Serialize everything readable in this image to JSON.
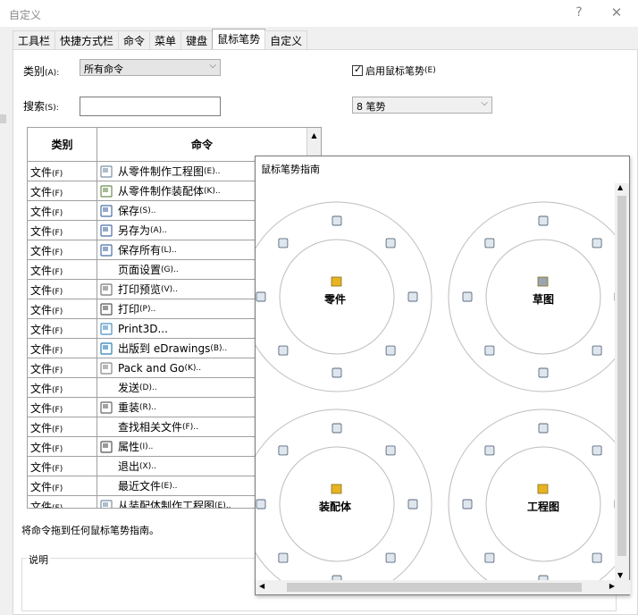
{
  "window": {
    "title": "自定义",
    "help": "?",
    "close": "✕"
  },
  "tabs": [
    "工具栏",
    "快捷方式栏",
    "命令",
    "菜单",
    "键盘",
    "鼠标笔势",
    "自定义"
  ],
  "category": {
    "label": "类别",
    "accel": "(A):",
    "value": "所有命令"
  },
  "search": {
    "label": "搜索",
    "accel": "(S):",
    "value": ""
  },
  "enable_gestures": {
    "label": "启用鼠标笔势",
    "accel": "(E)",
    "checked": true
  },
  "gesture_count": {
    "value": "8 笔势"
  },
  "table": {
    "headers": [
      "类别",
      "命令"
    ],
    "rows": [
      {
        "cat": "文件",
        "accel": "(F)",
        "cmd": "从零件制作工程图",
        "cmd_accel": "(E)..",
        "icon": "drawing-icon"
      },
      {
        "cat": "文件",
        "accel": "(F)",
        "cmd": "从零件制作装配体",
        "cmd_accel": "(K)..",
        "icon": "assembly-icon"
      },
      {
        "cat": "文件",
        "accel": "(F)",
        "cmd": "保存",
        "cmd_accel": "(S)..",
        "icon": "save-icon"
      },
      {
        "cat": "文件",
        "accel": "(F)",
        "cmd": "另存为",
        "cmd_accel": "(A)..",
        "icon": "save-as-icon"
      },
      {
        "cat": "文件",
        "accel": "(F)",
        "cmd": "保存所有",
        "cmd_accel": "(L)..",
        "icon": "save-all-icon"
      },
      {
        "cat": "文件",
        "accel": "(F)",
        "cmd": "页面设置",
        "cmd_accel": "(G)..",
        "icon": ""
      },
      {
        "cat": "文件",
        "accel": "(F)",
        "cmd": "打印预览",
        "cmd_accel": "(V)..",
        "icon": "print-preview-icon"
      },
      {
        "cat": "文件",
        "accel": "(F)",
        "cmd": "打印",
        "cmd_accel": "(P)..",
        "icon": "print-icon"
      },
      {
        "cat": "文件",
        "accel": "(F)",
        "cmd": "Print3D...",
        "cmd_accel": "",
        "icon": "print3d-icon"
      },
      {
        "cat": "文件",
        "accel": "(F)",
        "cmd": "出版到 eDrawings",
        "cmd_accel": "(B)..",
        "icon": "edrawings-icon"
      },
      {
        "cat": "文件",
        "accel": "(F)",
        "cmd": "Pack and Go",
        "cmd_accel": "(K)..",
        "icon": "pack-and-go-icon"
      },
      {
        "cat": "文件",
        "accel": "(F)",
        "cmd": "发送",
        "cmd_accel": "(D)..",
        "icon": ""
      },
      {
        "cat": "文件",
        "accel": "(F)",
        "cmd": "重装",
        "cmd_accel": "(R)..",
        "icon": "reload-icon"
      },
      {
        "cat": "文件",
        "accel": "(F)",
        "cmd": "查找相关文件",
        "cmd_accel": "(F)..",
        "icon": ""
      },
      {
        "cat": "文件",
        "accel": "(F)",
        "cmd": "属性",
        "cmd_accel": "(I)..",
        "icon": "properties-icon"
      },
      {
        "cat": "文件",
        "accel": "(F)",
        "cmd": "退出",
        "cmd_accel": "(X)..",
        "icon": ""
      },
      {
        "cat": "文件",
        "accel": "(F)",
        "cmd": "最近文件",
        "cmd_accel": "(E)..",
        "icon": ""
      },
      {
        "cat": "文件",
        "accel": "(F)",
        "cmd": "从装配体制作工程图",
        "cmd_accel": "(E)..",
        "icon": "drawing-icon"
      }
    ]
  },
  "hint": "将命令拖到任何鼠标笔势指南。",
  "description": {
    "label": "说明"
  },
  "gesture_guide": {
    "title": "鼠标笔势指南",
    "wheels": [
      {
        "name": "零件"
      },
      {
        "name": "草图"
      },
      {
        "name": "装配体"
      },
      {
        "name": "工程图"
      }
    ]
  }
}
